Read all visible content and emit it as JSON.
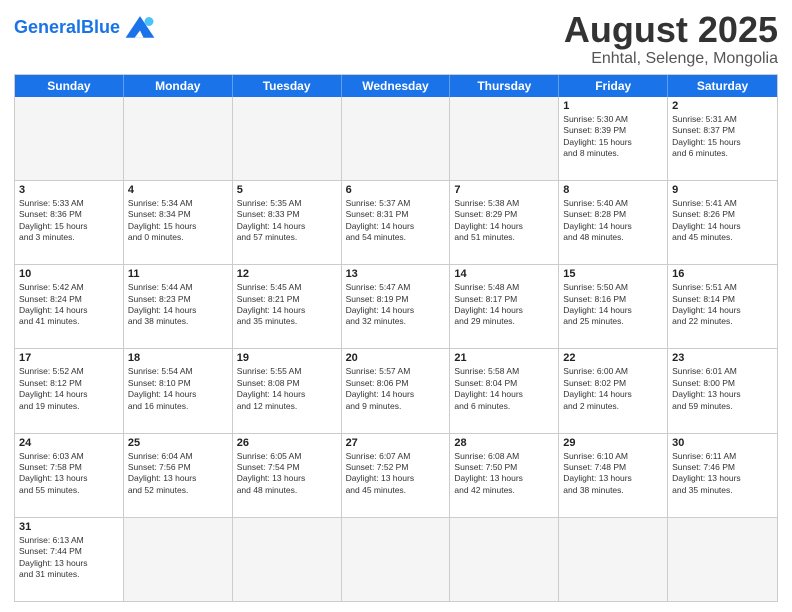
{
  "header": {
    "logo_general": "General",
    "logo_blue": "Blue",
    "title": "August 2025",
    "subtitle": "Enhtal, Selenge, Mongolia"
  },
  "weekdays": [
    "Sunday",
    "Monday",
    "Tuesday",
    "Wednesday",
    "Thursday",
    "Friday",
    "Saturday"
  ],
  "rows": [
    [
      {
        "day": "",
        "info": "",
        "empty": true
      },
      {
        "day": "",
        "info": "",
        "empty": true
      },
      {
        "day": "",
        "info": "",
        "empty": true
      },
      {
        "day": "",
        "info": "",
        "empty": true
      },
      {
        "day": "",
        "info": "",
        "empty": true
      },
      {
        "day": "1",
        "info": "Sunrise: 5:30 AM\nSunset: 8:39 PM\nDaylight: 15 hours\nand 8 minutes."
      },
      {
        "day": "2",
        "info": "Sunrise: 5:31 AM\nSunset: 8:37 PM\nDaylight: 15 hours\nand 6 minutes."
      }
    ],
    [
      {
        "day": "3",
        "info": "Sunrise: 5:33 AM\nSunset: 8:36 PM\nDaylight: 15 hours\nand 3 minutes."
      },
      {
        "day": "4",
        "info": "Sunrise: 5:34 AM\nSunset: 8:34 PM\nDaylight: 15 hours\nand 0 minutes."
      },
      {
        "day": "5",
        "info": "Sunrise: 5:35 AM\nSunset: 8:33 PM\nDaylight: 14 hours\nand 57 minutes."
      },
      {
        "day": "6",
        "info": "Sunrise: 5:37 AM\nSunset: 8:31 PM\nDaylight: 14 hours\nand 54 minutes."
      },
      {
        "day": "7",
        "info": "Sunrise: 5:38 AM\nSunset: 8:29 PM\nDaylight: 14 hours\nand 51 minutes."
      },
      {
        "day": "8",
        "info": "Sunrise: 5:40 AM\nSunset: 8:28 PM\nDaylight: 14 hours\nand 48 minutes."
      },
      {
        "day": "9",
        "info": "Sunrise: 5:41 AM\nSunset: 8:26 PM\nDaylight: 14 hours\nand 45 minutes."
      }
    ],
    [
      {
        "day": "10",
        "info": "Sunrise: 5:42 AM\nSunset: 8:24 PM\nDaylight: 14 hours\nand 41 minutes."
      },
      {
        "day": "11",
        "info": "Sunrise: 5:44 AM\nSunset: 8:23 PM\nDaylight: 14 hours\nand 38 minutes."
      },
      {
        "day": "12",
        "info": "Sunrise: 5:45 AM\nSunset: 8:21 PM\nDaylight: 14 hours\nand 35 minutes."
      },
      {
        "day": "13",
        "info": "Sunrise: 5:47 AM\nSunset: 8:19 PM\nDaylight: 14 hours\nand 32 minutes."
      },
      {
        "day": "14",
        "info": "Sunrise: 5:48 AM\nSunset: 8:17 PM\nDaylight: 14 hours\nand 29 minutes."
      },
      {
        "day": "15",
        "info": "Sunrise: 5:50 AM\nSunset: 8:16 PM\nDaylight: 14 hours\nand 25 minutes."
      },
      {
        "day": "16",
        "info": "Sunrise: 5:51 AM\nSunset: 8:14 PM\nDaylight: 14 hours\nand 22 minutes."
      }
    ],
    [
      {
        "day": "17",
        "info": "Sunrise: 5:52 AM\nSunset: 8:12 PM\nDaylight: 14 hours\nand 19 minutes."
      },
      {
        "day": "18",
        "info": "Sunrise: 5:54 AM\nSunset: 8:10 PM\nDaylight: 14 hours\nand 16 minutes."
      },
      {
        "day": "19",
        "info": "Sunrise: 5:55 AM\nSunset: 8:08 PM\nDaylight: 14 hours\nand 12 minutes."
      },
      {
        "day": "20",
        "info": "Sunrise: 5:57 AM\nSunset: 8:06 PM\nDaylight: 14 hours\nand 9 minutes."
      },
      {
        "day": "21",
        "info": "Sunrise: 5:58 AM\nSunset: 8:04 PM\nDaylight: 14 hours\nand 6 minutes."
      },
      {
        "day": "22",
        "info": "Sunrise: 6:00 AM\nSunset: 8:02 PM\nDaylight: 14 hours\nand 2 minutes."
      },
      {
        "day": "23",
        "info": "Sunrise: 6:01 AM\nSunset: 8:00 PM\nDaylight: 13 hours\nand 59 minutes."
      }
    ],
    [
      {
        "day": "24",
        "info": "Sunrise: 6:03 AM\nSunset: 7:58 PM\nDaylight: 13 hours\nand 55 minutes."
      },
      {
        "day": "25",
        "info": "Sunrise: 6:04 AM\nSunset: 7:56 PM\nDaylight: 13 hours\nand 52 minutes."
      },
      {
        "day": "26",
        "info": "Sunrise: 6:05 AM\nSunset: 7:54 PM\nDaylight: 13 hours\nand 48 minutes."
      },
      {
        "day": "27",
        "info": "Sunrise: 6:07 AM\nSunset: 7:52 PM\nDaylight: 13 hours\nand 45 minutes."
      },
      {
        "day": "28",
        "info": "Sunrise: 6:08 AM\nSunset: 7:50 PM\nDaylight: 13 hours\nand 42 minutes."
      },
      {
        "day": "29",
        "info": "Sunrise: 6:10 AM\nSunset: 7:48 PM\nDaylight: 13 hours\nand 38 minutes."
      },
      {
        "day": "30",
        "info": "Sunrise: 6:11 AM\nSunset: 7:46 PM\nDaylight: 13 hours\nand 35 minutes."
      }
    ],
    [
      {
        "day": "31",
        "info": "Sunrise: 6:13 AM\nSunset: 7:44 PM\nDaylight: 13 hours\nand 31 minutes."
      },
      {
        "day": "",
        "info": "",
        "empty": true
      },
      {
        "day": "",
        "info": "",
        "empty": true
      },
      {
        "day": "",
        "info": "",
        "empty": true
      },
      {
        "day": "",
        "info": "",
        "empty": true
      },
      {
        "day": "",
        "info": "",
        "empty": true
      },
      {
        "day": "",
        "info": "",
        "empty": true
      }
    ]
  ]
}
